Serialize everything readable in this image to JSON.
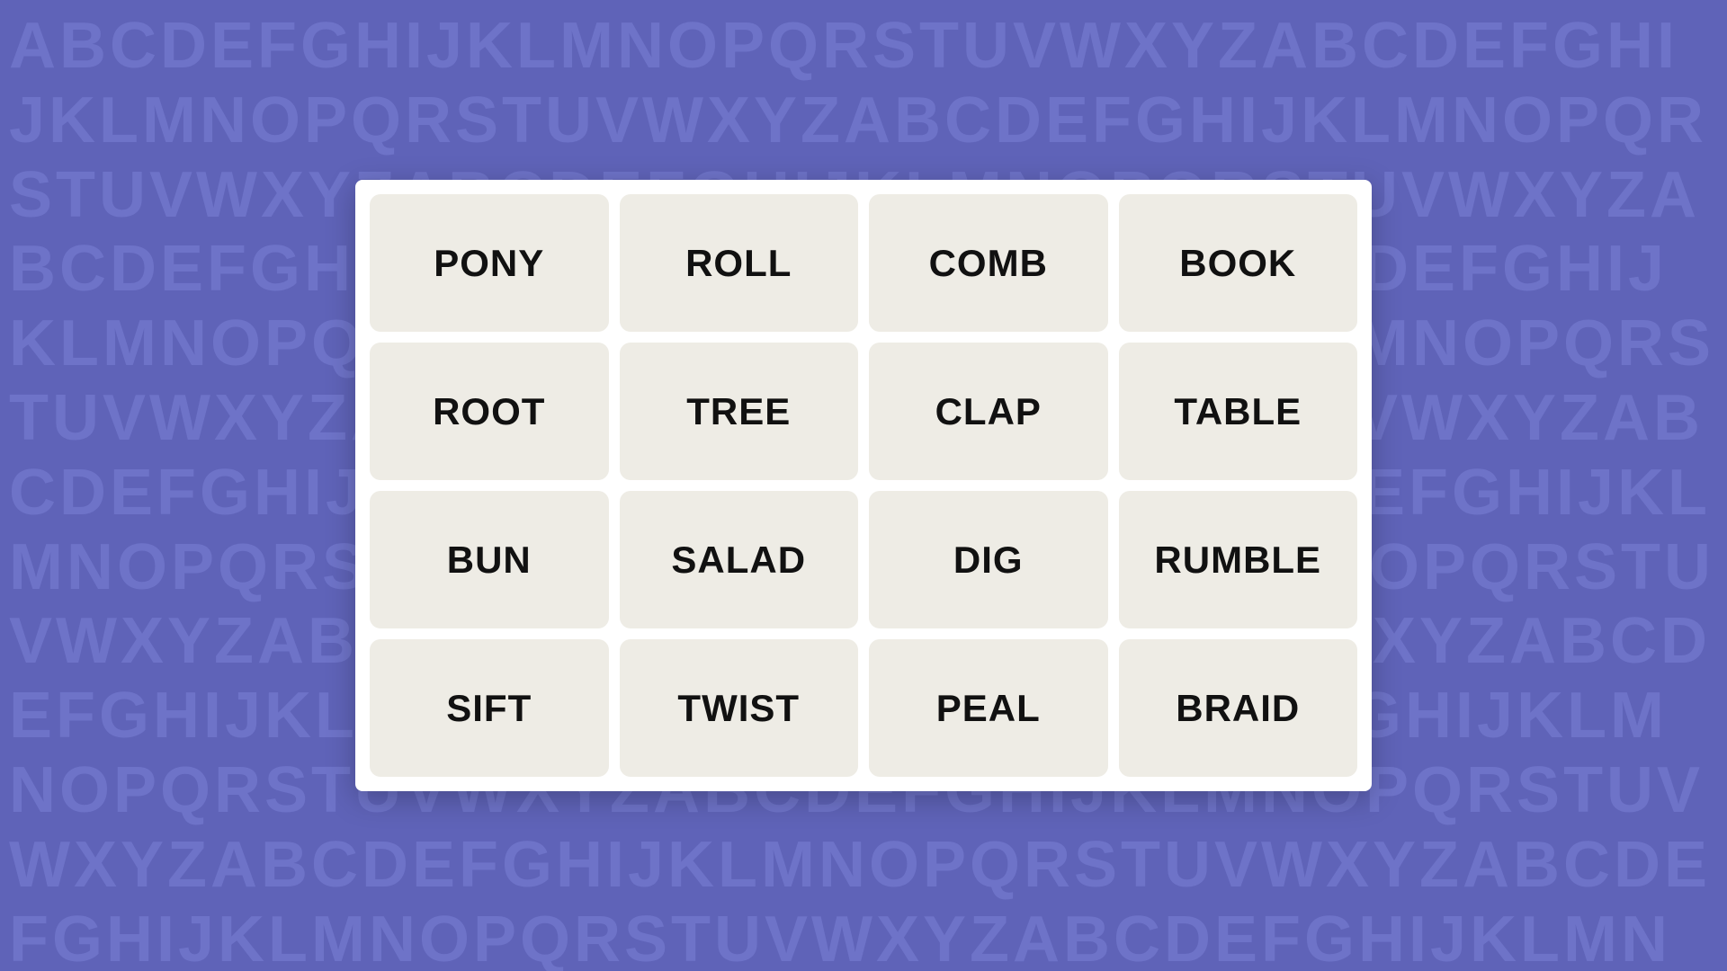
{
  "background": {
    "color": "#5f63b8",
    "alphabet_text": "ABCDEFGHIJKLMNOPQRSTUVWXYZABCDEFGHIJKLMNOPQRSTUVWXYZABCDEFGHIJKLMNOPQRSTUVWXYZABCDEFGHIJKLMNOPQRSTUVWXYZABCDEFGHIJKLMNOPQRSTUVWXYZABCDEFGHIJKLMNOPQRSTUVWXYZABCDEFGHIJKLMNOPQRSTUVWXYZABCDEFGHIJKLMNOPQRSTUVWXYZABCDEFGHIJKLMNOPQRSTUVWXYZABCDEFGHIJKLMNOPQRSTUVWXYZ"
  },
  "grid": {
    "words": [
      "PONY",
      "ROLL",
      "COMB",
      "BOOK",
      "ROOT",
      "TREE",
      "CLAP",
      "TABLE",
      "BUN",
      "SALAD",
      "DIG",
      "RUMBLE",
      "SIFT",
      "TWIST",
      "PEAL",
      "BRAID"
    ]
  }
}
